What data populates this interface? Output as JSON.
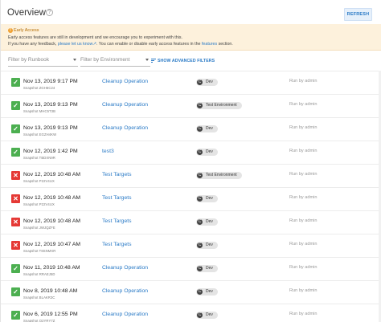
{
  "header": {
    "title": "Overview",
    "help_icon": "question-circle-icon",
    "refresh_label": "REFRESH"
  },
  "banner": {
    "icon": "info-icon",
    "title": "Early Access",
    "line1": "Early access features are still in development and we encourage you to experiment with this.",
    "line2_pre": "If you have any feedback,",
    "line2_link": "please let us know",
    "line2_mid": ". You can enable or disable early access features in the",
    "line2_link2": "features",
    "line2_post": "section."
  },
  "filters": {
    "runbook_placeholder": "Filter by Runbook",
    "environment_placeholder": "Filter by Environment",
    "advanced_label": "SHOW ADVANCED FILTERS"
  },
  "colors": {
    "accent": "#2a7ac6",
    "success": "#4caf50",
    "failure": "#e53935",
    "banner_bg": "#fdf1dc"
  },
  "runs": [
    {
      "status": "success",
      "date": "Nov 13, 2019 9:17 PM",
      "snapshot": "Snapshot ZGH6C24",
      "runbook": "Cleanup Operation",
      "environment": "Dev",
      "run_by": "Run by admin"
    },
    {
      "status": "success",
      "date": "Nov 13, 2019 9:13 PM",
      "snapshot": "Snapshot MHC5T3B",
      "runbook": "Cleanup Operation",
      "environment": "Test Environment",
      "run_by": "Run by admin"
    },
    {
      "status": "success",
      "date": "Nov 13, 2019 9:13 PM",
      "snapshot": "Snapshot EGZH4KW",
      "runbook": "Cleanup Operation",
      "environment": "Dev",
      "run_by": "Run by admin"
    },
    {
      "status": "success",
      "date": "Nov 12, 2019 1:42 PM",
      "snapshot": "Snapshot TBDXN9R",
      "runbook": "test3",
      "environment": "Dev",
      "run_by": "Run by admin"
    },
    {
      "status": "failure",
      "date": "Nov 12, 2019 10:48 AM",
      "snapshot": "Snapshot P22V4UX",
      "runbook": "Test Targets",
      "environment": "Test Environment",
      "run_by": "Run by admin"
    },
    {
      "status": "failure",
      "date": "Nov 12, 2019 10:48 AM",
      "snapshot": "Snapshot P22V4UX",
      "runbook": "Test Targets",
      "environment": "Dev",
      "run_by": "Run by admin"
    },
    {
      "status": "failure",
      "date": "Nov 12, 2019 10:48 AM",
      "snapshot": "Snapshot JWJQZFE",
      "runbook": "Test Targets",
      "environment": "Dev",
      "run_by": "Run by admin"
    },
    {
      "status": "failure",
      "date": "Nov 12, 2019 10:47 AM",
      "snapshot": "Snapshot T8SNMXR",
      "runbook": "Test Targets",
      "environment": "Dev",
      "run_by": "Run by admin"
    },
    {
      "status": "success",
      "date": "Nov 11, 2019 10:48 AM",
      "snapshot": "Snapshot RRAEJ5D",
      "runbook": "Cleanup Operation",
      "environment": "Dev",
      "run_by": "Run by admin"
    },
    {
      "status": "success",
      "date": "Nov 8, 2019 10:48 AM",
      "snapshot": "Snapshot BLAKR3C",
      "runbook": "Cleanup Operation",
      "environment": "Dev",
      "run_by": "Run by admin"
    },
    {
      "status": "success",
      "date": "Nov 6, 2019 12:55 PM",
      "snapshot": "Snapshot Q2YRY7Z",
      "runbook": "Cleanup Operation",
      "environment": "Dev",
      "run_by": "Run by admin"
    }
  ]
}
